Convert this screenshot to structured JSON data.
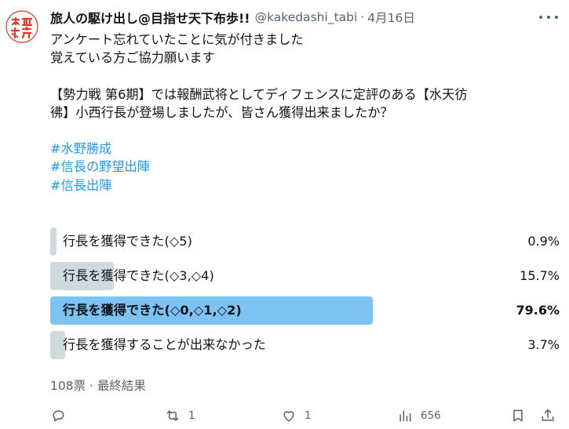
{
  "author": {
    "name": "旅人の駆け出し@目指せ天下布歩!!",
    "handle": "@kakedashi_tabi",
    "separator": "·",
    "date": "4月16日"
  },
  "tweet": {
    "line1": "アンケート忘れていたことに気が付きました",
    "line2": "覚えている方ご協力願います",
    "line3": "【勢力戦 第6期】では報酬武将としてディフェンスに定評のある【水天彷",
    "line4": "彿】小西行長が登場しましたが、皆さん獲得出来ましたか？",
    "hashtags": [
      "#水野勝成",
      "#信長の野望出陣",
      "#信長出陣"
    ]
  },
  "poll": {
    "options": [
      {
        "label": "行長を獲得できた(◇5)",
        "percent_text": "0.9%",
        "percent": 0.9,
        "winner": false
      },
      {
        "label": "行長を獲得できた(◇3,◇4)",
        "percent_text": "15.7%",
        "percent": 15.7,
        "winner": false
      },
      {
        "label": "行長を獲得できた(◇0,◇1,◇2)",
        "percent_text": "79.6%",
        "percent": 79.6,
        "winner": true
      },
      {
        "label": "行長を獲得することが出来なかった",
        "percent_text": "3.7%",
        "percent": 3.7,
        "winner": false
      }
    ],
    "votes": "108票",
    "separator": "·",
    "status": "最終結果"
  },
  "actions": {
    "reply_icon": "reply-icon",
    "retweet_icon": "retweet-icon",
    "retweet_count": "1",
    "like_icon": "like-icon",
    "like_count": "1",
    "views_icon": "views-icon",
    "views_count": "656",
    "bookmark_icon": "bookmark-icon",
    "share_icon": "share-icon"
  },
  "colors": {
    "winner_bar": "#7cc3f3",
    "bar": "#cfd9de",
    "hashtag": "#1d9bf0",
    "muted": "#536471",
    "avatar_red": "#e0392e"
  }
}
